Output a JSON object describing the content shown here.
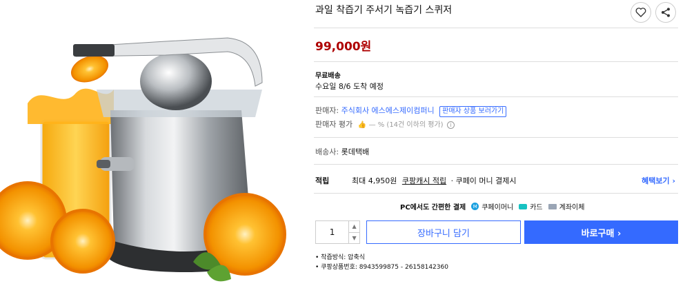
{
  "title": "과일 착즙기 주서기 녹즙기 스퀴저",
  "price": "99,000원",
  "shipping": {
    "label": "무료배송",
    "arrival": "수요일 8/6 도착 예정"
  },
  "seller": {
    "label": "판매자:",
    "name": "주식회사 에스에스제이컴퍼니",
    "view_products": "판매자 상품 보러가기",
    "rating_label": "판매자 평가",
    "rating_text": "— % (14건 이하의 평가)"
  },
  "delivery": {
    "label": "배송사:",
    "company": "롯데택배"
  },
  "reward": {
    "label": "적립",
    "text_prefix": "최대 4,950원",
    "cash_link": "쿠팡캐시 적립",
    "text_suffix": "· 쿠페이 머니 결제시",
    "benefit_link": "혜택보기 ›"
  },
  "payment": {
    "label": "PC에서도 간편한 결제",
    "options": [
      "쿠페이머니",
      "카드",
      "계좌이체"
    ]
  },
  "quantity": "1",
  "buttons": {
    "cart": "장바구니 담기",
    "buy": "바로구매 ›"
  },
  "details": [
    "착즙방식: 압축식",
    "쿠팡상품번호: 8943599875 - 26158142360"
  ],
  "colors": {
    "price": "#ae0000",
    "accent": "#346aff"
  }
}
